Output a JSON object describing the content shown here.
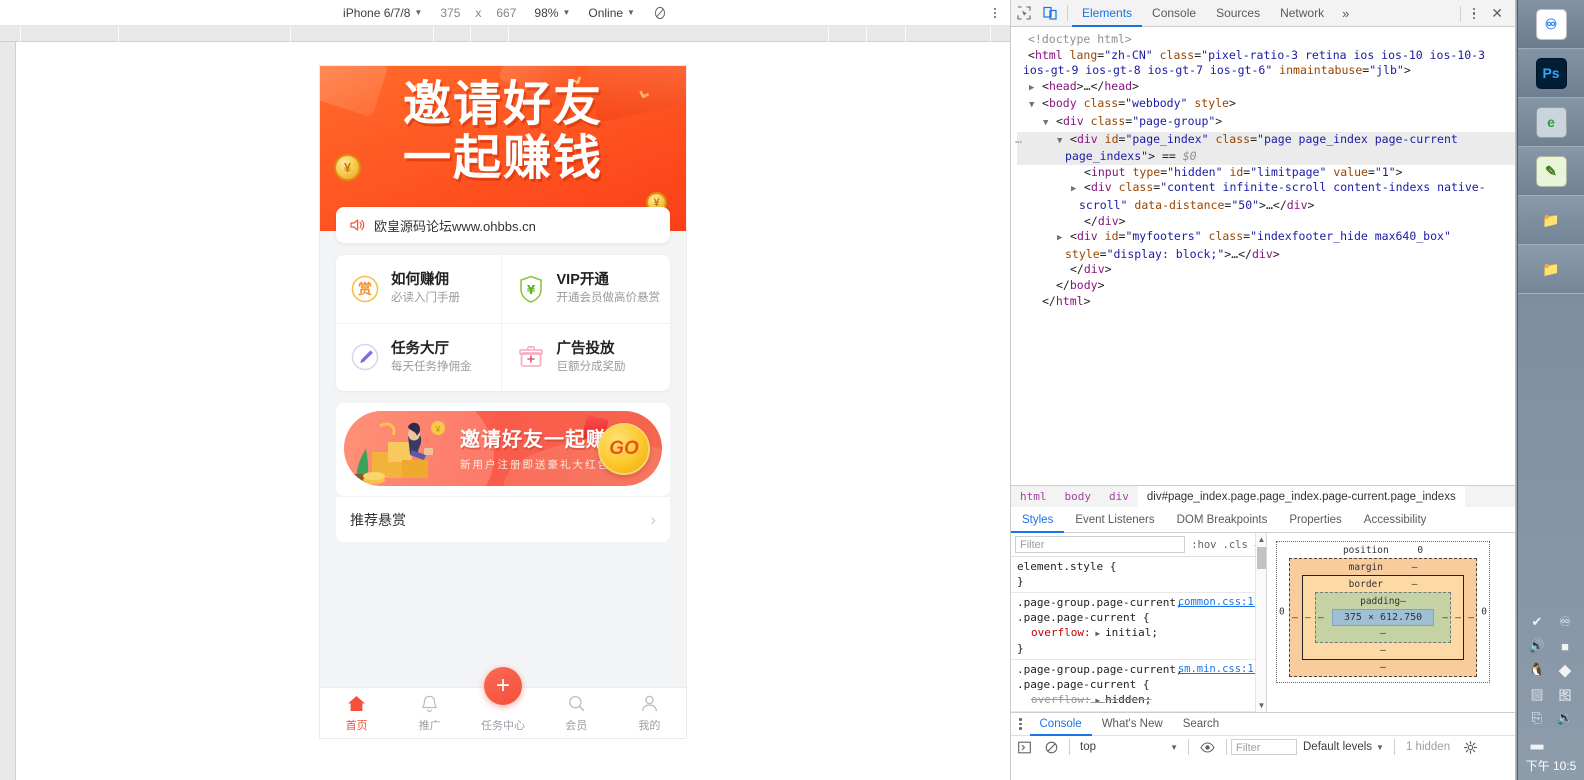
{
  "device_toolbar": {
    "device": "iPhone 6/7/8",
    "width": "375",
    "separator": "x",
    "height": "667",
    "zoom": "98%",
    "network": "Online",
    "throttle_icon": "no-throttling-icon",
    "menu_icon": "more-options-icon"
  },
  "phone": {
    "hero": {
      "line1": "邀请好友",
      "line2": "一起赚钱",
      "coin_symbol": "¥"
    },
    "notice": {
      "icon": "speaker-icon",
      "text": "欧皇源码论坛www.ohbbs.cn"
    },
    "grid": [
      {
        "icon": "award-badge-icon",
        "icon_char": "赏",
        "title": "如何赚佣",
        "subtitle": "必读入门手册"
      },
      {
        "icon": "shield-yuan-icon",
        "icon_char": "¥",
        "title": "VIP开通",
        "subtitle": "开通会员做高价悬赏"
      },
      {
        "icon": "pencil-icon",
        "icon_char": "✎",
        "title": "任务大厅",
        "subtitle": "每天任务挣佣金"
      },
      {
        "icon": "gift-box-icon",
        "icon_char": "+",
        "title": "广告投放",
        "subtitle": "巨额分成奖励"
      }
    ],
    "promo": {
      "title": "邀请好友一起赚钱",
      "subtitle": "新用户注册即送豪礼大红包",
      "button": "GO",
      "art_icon": "person-with-coins-illustration"
    },
    "list_row": {
      "label": "推荐悬赏",
      "chevron": "chevron-right-icon"
    },
    "tabbar": [
      {
        "icon": "home-icon",
        "label": "首页",
        "active": true
      },
      {
        "icon": "bell-icon",
        "label": "推广",
        "active": false
      },
      {
        "icon": "plus-fab-icon",
        "label": "任务中心",
        "active": false,
        "fab": "+"
      },
      {
        "icon": "search-icon",
        "label": "会员",
        "active": false
      },
      {
        "icon": "person-icon",
        "label": "我的",
        "active": false
      }
    ]
  },
  "devtools": {
    "inspect_icon": "inspect-element-icon",
    "device_toggle_icon": "toggle-device-toolbar-icon",
    "tabs": [
      {
        "label": "Elements",
        "active": true
      },
      {
        "label": "Console",
        "active": false
      },
      {
        "label": "Sources",
        "active": false
      },
      {
        "label": "Network",
        "active": false
      }
    ],
    "more_tabs": "»",
    "settings_icon": "more-tools-icon",
    "close_icon": "close-devtools-icon",
    "dom": [
      {
        "indent": 0,
        "twisty": "",
        "parts": [
          [
            "doctype",
            "<!doctype html>"
          ]
        ]
      },
      {
        "indent": 0,
        "twisty": "",
        "parts": [
          [
            "punc",
            "<"
          ],
          [
            "tag",
            "html"
          ],
          [
            "attr",
            " lang"
          ],
          [
            "punc",
            "="
          ],
          [
            "val",
            "\"zh-CN\""
          ],
          [
            "attr",
            " class"
          ],
          [
            "punc",
            "="
          ],
          [
            "val",
            "\"pixel-ratio-3 retina ios ios-10 ios-10-3 ios-gt-9 ios-gt-8 ios-gt-7 ios-gt-6\""
          ],
          [
            "attr",
            " inmaintabuse"
          ],
          [
            "punc",
            "="
          ],
          [
            "val",
            "\"jlb\""
          ],
          [
            "punc",
            ">"
          ]
        ]
      },
      {
        "indent": 1,
        "twisty": "▶",
        "parts": [
          [
            "punc",
            "<"
          ],
          [
            "tag",
            "head"
          ],
          [
            "punc",
            ">…</"
          ],
          [
            "tag",
            "head"
          ],
          [
            "punc",
            ">"
          ]
        ]
      },
      {
        "indent": 1,
        "twisty": "▼",
        "parts": [
          [
            "punc",
            "<"
          ],
          [
            "tag",
            "body"
          ],
          [
            "attr",
            " class"
          ],
          [
            "punc",
            "="
          ],
          [
            "val",
            "\"webbody\""
          ],
          [
            "attr",
            " style"
          ],
          [
            "punc",
            ">"
          ]
        ]
      },
      {
        "indent": 2,
        "twisty": "▼",
        "parts": [
          [
            "punc",
            "<"
          ],
          [
            "tag",
            "div"
          ],
          [
            "attr",
            " class"
          ],
          [
            "punc",
            "="
          ],
          [
            "val",
            "\"page-group\""
          ],
          [
            "punc",
            ">"
          ]
        ]
      },
      {
        "indent": 3,
        "twisty": "▼",
        "selected": true,
        "dots": "…",
        "parts": [
          [
            "punc",
            "<"
          ],
          [
            "tag",
            "div"
          ],
          [
            "attr",
            " id"
          ],
          [
            "punc",
            "="
          ],
          [
            "val",
            "\"page_index\""
          ],
          [
            "attr",
            " class"
          ],
          [
            "punc",
            "="
          ],
          [
            "val",
            "\"page page_index page-current page_indexs\""
          ],
          [
            "punc",
            "> == "
          ],
          [
            "selmark",
            "$0"
          ]
        ]
      },
      {
        "indent": 4,
        "twisty": "",
        "parts": [
          [
            "punc",
            "<"
          ],
          [
            "tag",
            "input"
          ],
          [
            "attr",
            " type"
          ],
          [
            "punc",
            "="
          ],
          [
            "val",
            "\"hidden\""
          ],
          [
            "attr",
            " id"
          ],
          [
            "punc",
            "="
          ],
          [
            "val",
            "\"limitpage\""
          ],
          [
            "attr",
            " value"
          ],
          [
            "punc",
            "="
          ],
          [
            "val",
            "\"1\""
          ],
          [
            "punc",
            ">"
          ]
        ]
      },
      {
        "indent": 4,
        "twisty": "▶",
        "parts": [
          [
            "punc",
            "<"
          ],
          [
            "tag",
            "div"
          ],
          [
            "attr",
            " class"
          ],
          [
            "punc",
            "="
          ],
          [
            "val",
            "\"content infinite-scroll content-indexs native-scroll\""
          ],
          [
            "attr",
            " data-distance"
          ],
          [
            "punc",
            "="
          ],
          [
            "val",
            "\"50\""
          ],
          [
            "punc",
            ">…</"
          ],
          [
            "tag",
            "div"
          ],
          [
            "punc",
            ">"
          ]
        ]
      },
      {
        "indent": 4,
        "twisty": "",
        "parts": [
          [
            "punc",
            "</"
          ],
          [
            "tag",
            "div"
          ],
          [
            "punc",
            ">"
          ]
        ]
      },
      {
        "indent": 3,
        "twisty": "▶",
        "parts": [
          [
            "punc",
            "<"
          ],
          [
            "tag",
            "div"
          ],
          [
            "attr",
            " id"
          ],
          [
            "punc",
            "="
          ],
          [
            "val",
            "\"myfooters\""
          ],
          [
            "attr",
            " class"
          ],
          [
            "punc",
            "="
          ],
          [
            "val",
            "\"indexfooter_hide max640_box\""
          ],
          [
            "attr",
            " style"
          ],
          [
            "punc",
            "="
          ],
          [
            "val",
            "\"display: block;\""
          ],
          [
            "punc",
            ">…</"
          ],
          [
            "tag",
            "div"
          ],
          [
            "punc",
            ">"
          ]
        ]
      },
      {
        "indent": 3,
        "twisty": "",
        "parts": [
          [
            "punc",
            "</"
          ],
          [
            "tag",
            "div"
          ],
          [
            "punc",
            ">"
          ]
        ]
      },
      {
        "indent": 2,
        "twisty": "",
        "parts": [
          [
            "punc",
            "</"
          ],
          [
            "tag",
            "body"
          ],
          [
            "punc",
            ">"
          ]
        ]
      },
      {
        "indent": 1,
        "twisty": "",
        "parts": [
          [
            "punc",
            "</"
          ],
          [
            "tag",
            "html"
          ],
          [
            "punc",
            ">"
          ]
        ]
      }
    ],
    "breadcrumb": [
      "html",
      "body",
      "div",
      "div#page_index.page.page_index.page-current.page_indexs"
    ],
    "sidebar_tabs": [
      {
        "label": "Styles",
        "active": true
      },
      {
        "label": "Event Listeners",
        "active": false
      },
      {
        "label": "DOM Breakpoints",
        "active": false
      },
      {
        "label": "Properties",
        "active": false
      },
      {
        "label": "Accessibility",
        "active": false
      }
    ],
    "filter_placeholder": "Filter",
    "hov_label": ":hov",
    "cls_label": ".cls",
    "plus_label": "+",
    "rules": [
      {
        "selector": "element.style {",
        "close": "}",
        "source": "",
        "decls": []
      },
      {
        "selector": ".page-group.page-current, .page.page-current {",
        "close": "}",
        "source": "common.css:11",
        "decls": [
          {
            "prop": "overflow",
            "value": "initial;",
            "struck": false
          }
        ]
      },
      {
        "selector": ".page-group.page-current, .page.page-current {",
        "close": "",
        "source": "sm.min.css:11",
        "decls": [
          {
            "prop": "overflow",
            "value": "hidden;",
            "struck": true
          }
        ]
      }
    ],
    "box_model": {
      "position_label": "position",
      "position_value": "0",
      "margin_label": "margin",
      "margin_value": "–",
      "border_label": "border",
      "border_value": "–",
      "padding_label": "padding",
      "padding_value": "–",
      "content": "375 × 612.750",
      "left_outer": "0",
      "right_outer": "0",
      "dash": "–"
    },
    "drawer": {
      "kebab_icon": "drawer-more-icon",
      "tabs": [
        {
          "label": "Console",
          "active": true
        },
        {
          "label": "What's New",
          "active": false
        },
        {
          "label": "Search",
          "active": false
        }
      ],
      "console_toolbar": {
        "sidebar_icon": "console-sidebar-icon",
        "clear_icon": "clear-console-icon",
        "context": "top",
        "eye_icon": "live-expression-icon",
        "filter_placeholder": "Filter",
        "levels": "Default levels",
        "hidden": "1 hidden",
        "settings_icon": "console-settings-icon"
      }
    }
  },
  "taskbar": {
    "apps": [
      {
        "name": "baidu-netdisk-icon",
        "glyph": "♾",
        "bg": "#ffffff",
        "fg": "#2b7ff5"
      },
      {
        "name": "photoshop-icon",
        "glyph": "Ps",
        "bg": "#001e36",
        "fg": "#31a8ff"
      },
      {
        "name": "internet-explorer-icon",
        "glyph": "e",
        "bg": "#c9d4dc",
        "fg": "#2e9e3e"
      },
      {
        "name": "notepadpp-icon",
        "glyph": "✎",
        "bg": "#e9f5d8",
        "fg": "#3d7a1d"
      },
      {
        "name": "folder-icon",
        "glyph": "📁",
        "bg": "transparent",
        "fg": "#f1c04a"
      },
      {
        "name": "folder-icon",
        "glyph": "📁",
        "bg": "transparent",
        "fg": "#f1c04a"
      }
    ],
    "tray": [
      {
        "name": "usb-safe-remove-icon",
        "glyph": "✔"
      },
      {
        "name": "baidu-cloud-tray-icon",
        "glyph": "♾"
      },
      {
        "name": "volume-icon",
        "glyph": "🔊"
      },
      {
        "name": "nvidia-icon",
        "glyph": "■"
      },
      {
        "name": "qq-icon",
        "glyph": "🐧"
      },
      {
        "name": "security-shield-icon",
        "glyph": "◆"
      },
      {
        "name": "window-app-icon",
        "glyph": "▧"
      },
      {
        "name": "input-method-icon",
        "glyph": "图"
      },
      {
        "name": "clipboard-icon",
        "glyph": "⎘"
      },
      {
        "name": "speaker-tray-icon",
        "glyph": "🔉"
      },
      {
        "name": "signal-bars-icon",
        "glyph": "▃"
      }
    ],
    "clock": "下午 10:5"
  }
}
